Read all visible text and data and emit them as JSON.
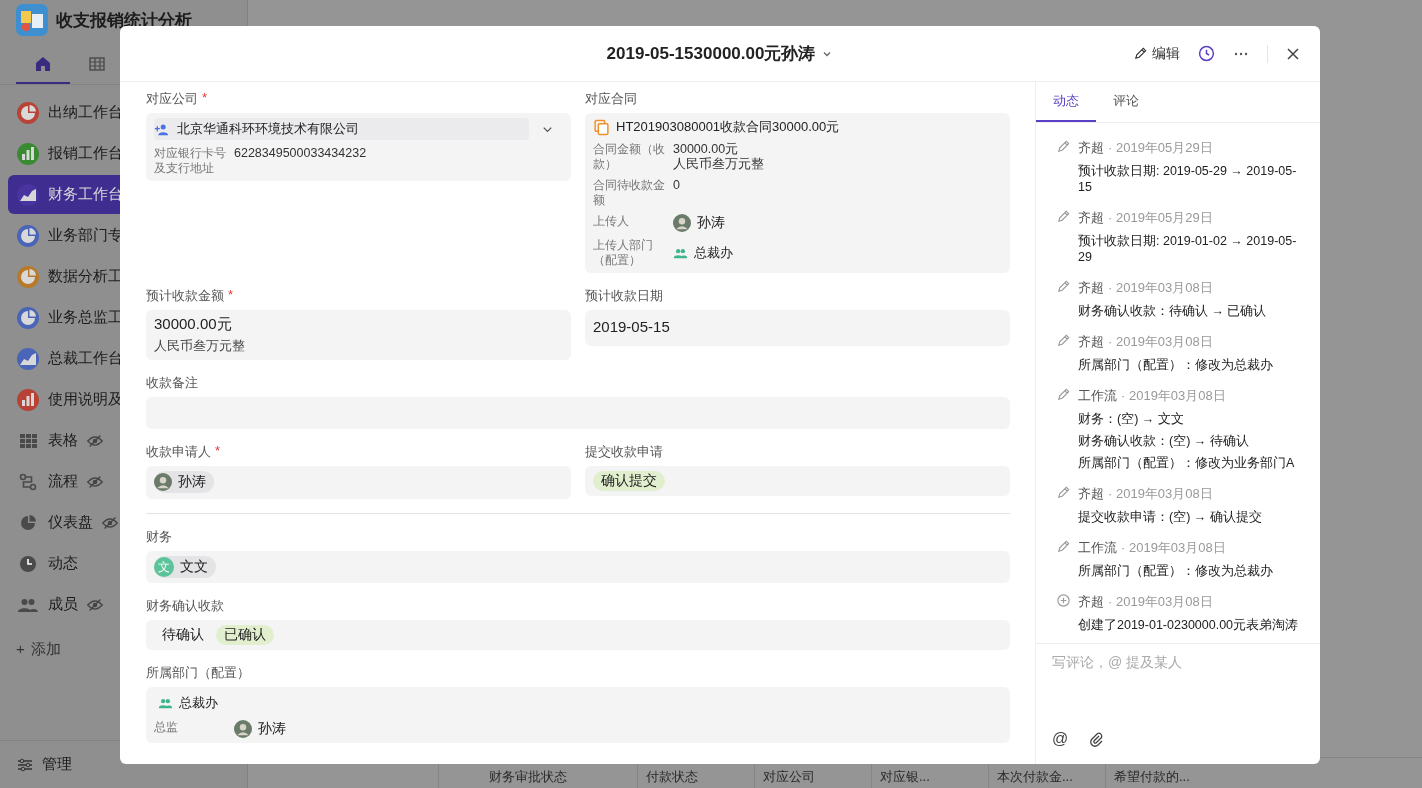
{
  "app": {
    "title": "收支报销统计分析",
    "nav_tabs": [
      {
        "kind": "home",
        "selected": true
      },
      {
        "kind": "table",
        "selected": false
      }
    ]
  },
  "sidebar": {
    "items": [
      {
        "label": "出纳工作台",
        "kind": "pie",
        "color": "#b84236",
        "selected": false
      },
      {
        "label": "报销工作台",
        "kind": "bar",
        "color": "#3a8a32",
        "selected": false
      },
      {
        "label": "财务工作台",
        "kind": "area",
        "color": "#4a34a0",
        "selected": true
      },
      {
        "label": "业务部门专",
        "kind": "pie",
        "color": "#4a64b8",
        "selected": false
      },
      {
        "label": "数据分析工",
        "kind": "pie",
        "color": "#b87a2a",
        "selected": false
      },
      {
        "label": "业务总监工",
        "kind": "pie",
        "color": "#4a64b8",
        "selected": false
      },
      {
        "label": "总裁工作台",
        "kind": "area",
        "color": "#4a64b8",
        "selected": false
      },
      {
        "label": "使用说明及",
        "kind": "bar",
        "color": "#b84236",
        "selected": false
      },
      {
        "label": "表格",
        "kind": "grid",
        "hidden": true
      },
      {
        "label": "流程",
        "kind": "flow",
        "hidden": true
      },
      {
        "label": "仪表盘",
        "kind": "pie",
        "hidden": true
      },
      {
        "label": "动态",
        "kind": "clock",
        "hidden": false
      },
      {
        "label": "成员",
        "kind": "people",
        "hidden": true
      }
    ],
    "add_symbol": "+",
    "add_label": "添加",
    "manage_label": "管理"
  },
  "background_table": {
    "columns": [
      "财务审批状态",
      "付款状态",
      "对应公司",
      "对应银...",
      "本次付款金...",
      "希望付款的..."
    ]
  },
  "record": {
    "title": "2019-05-1530000.00元孙涛",
    "edit_label": "编辑",
    "required_mark": "*",
    "rows": [
      {
        "kind": "fields",
        "fields": [
          {
            "kind": "company",
            "label": "对应公司",
            "required": true,
            "value": "北京华通科环环境技术有限公司",
            "details": [
              {
                "label": "对应银行卡号及支行地址",
                "value": "6228349500033434232"
              }
            ]
          },
          {
            "kind": "contract",
            "label": "对应合同",
            "value": "HT201903080001收款合同30000.00元",
            "details": [
              {
                "kind": "text",
                "label": "合同金额（收款）",
                "lines": [
                  "30000.00元",
                  "人民币叁万元整"
                ]
              },
              {
                "kind": "text",
                "label": "合同待收款金额",
                "lines": [
                  "0"
                ]
              },
              {
                "kind": "person",
                "label": "上传人",
                "name": "孙涛"
              },
              {
                "kind": "department",
                "label": "上传人部门（配置）",
                "name": "总裁办"
              }
            ]
          }
        ]
      },
      {
        "kind": "fields",
        "fields": [
          {
            "kind": "amount",
            "label": "预计收款金额",
            "required": true,
            "value": "30000.00元",
            "note": "人民币叁万元整"
          },
          {
            "kind": "date",
            "label": "预计收款日期",
            "value": "2019-05-15"
          }
        ]
      },
      {
        "kind": "fields",
        "fields": [
          {
            "kind": "text",
            "label": "收款备注"
          }
        ]
      },
      {
        "kind": "fields",
        "fields": [
          {
            "kind": "people",
            "label": "收款申请人",
            "required": true,
            "people": [
              {
                "name": "孙涛",
                "kind": "photo"
              }
            ]
          },
          {
            "kind": "tags",
            "label": "提交收款申请",
            "tags": [
              "确认提交"
            ]
          }
        ]
      },
      {
        "kind": "divider"
      },
      {
        "kind": "fields",
        "fields": [
          {
            "kind": "people",
            "label": "财务",
            "people": [
              {
                "name": "文文",
                "kind": "initial",
                "initial": "文"
              }
            ]
          }
        ]
      },
      {
        "kind": "fields",
        "fields": [
          {
            "kind": "options",
            "label": "财务确认收款",
            "options": [
              {
                "label": "待确认",
                "selected": false
              },
              {
                "label": "已确认",
                "selected": true
              }
            ]
          }
        ]
      },
      {
        "kind": "fields",
        "fields": [
          {
            "kind": "department",
            "label": "所属部门（配置）",
            "value": "总裁办",
            "details": [
              {
                "kind": "person",
                "label": "总监",
                "name": "孙涛"
              }
            ]
          }
        ]
      }
    ],
    "activity": {
      "tabs": [
        {
          "label": "动态",
          "selected": true
        },
        {
          "label": "评论",
          "selected": false
        }
      ],
      "entries": [
        {
          "kind": "edit",
          "author": "齐超",
          "date": "· 2019年05月29日",
          "lines": [
            "预计收款日期: 2019-05-29 → 2019-05-15"
          ]
        },
        {
          "kind": "edit",
          "author": "齐超",
          "date": "· 2019年05月29日",
          "lines": [
            "预计收款日期: 2019-01-02 → 2019-05-29"
          ]
        },
        {
          "kind": "edit",
          "author": "齐超",
          "date": "· 2019年03月08日",
          "lines": [
            "财务确认收款：待确认 → 已确认"
          ]
        },
        {
          "kind": "edit",
          "author": "齐超",
          "date": "· 2019年03月08日",
          "lines": [
            "所属部门（配置）：修改为总裁办"
          ]
        },
        {
          "kind": "edit",
          "author": "工作流",
          "date": "· 2019年03月08日",
          "lines": [
            "财务：(空) → 文文",
            "财务确认收款：(空) → 待确认",
            "所属部门（配置）：修改为业务部门A"
          ]
        },
        {
          "kind": "edit",
          "author": "齐超",
          "date": "· 2019年03月08日",
          "lines": [
            "提交收款申请：(空) → 确认提交"
          ]
        },
        {
          "kind": "edit",
          "author": "工作流",
          "date": "· 2019年03月08日",
          "lines": [
            "所属部门（配置）：修改为总裁办"
          ]
        },
        {
          "kind": "create",
          "author": "齐超",
          "date": "· 2019年03月08日",
          "lines": [
            "创建了2019-01-0230000.00元表弟淘涛"
          ]
        }
      ],
      "comment_placeholder": "写评论，@ 提及某人",
      "mention_symbol": "@"
    }
  }
}
